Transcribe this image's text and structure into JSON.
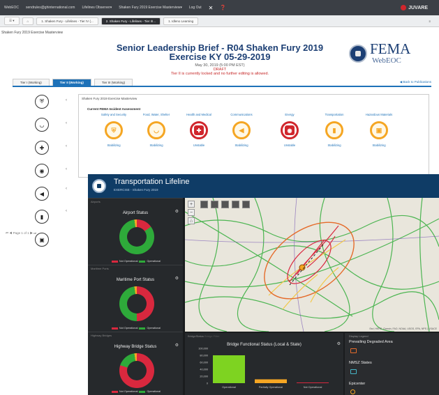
{
  "topbar": {
    "items": [
      "WebEOC",
      "sendrules@ghinternational.com",
      "Lifelines Observer▾",
      "Shaken Fury 2019 Exercise Masterview▾",
      "Log Out"
    ],
    "brand": "JUVARE"
  },
  "tabs": [
    {
      "label": "1. Shaken Fury - Lifelines - Tier IV (...",
      "active": false
    },
    {
      "label": "2. Shaken Fury - Lifelines - Tier I/I...",
      "active": true
    },
    {
      "label": "1. Idleno Learning",
      "active": false
    }
  ],
  "breadcrumb": "Shaken Fury 2019 Exercise Masterview",
  "header": {
    "title": "Senior Leadership Brief - R04 Shaken Fury 2019",
    "subtitle": "Exercise KY 05-29-2019",
    "date": "May 30, 2019 (5:00 PM EST)",
    "draft": "DRAFT",
    "locked": "Tier II is currently locked and no further editing is allowed."
  },
  "logo": {
    "name": "FEMA",
    "sub": "WebEOC"
  },
  "tier_tabs": [
    "Tier I (Working)",
    "Tier II (Working)",
    "Tier III (Working)"
  ],
  "back_link": "Back to Publications",
  "panel": {
    "title": "Shaken Fury 2019 Exercise Masterview",
    "assessment": "Current FEMA Incident Assessment",
    "lifelines": [
      {
        "name": "Safety and Security",
        "status": "Stabilizing",
        "icon": "shield-icon",
        "state": "yellow"
      },
      {
        "name": "Food, Water, Shelter",
        "status": "Stabilizing",
        "icon": "food-icon",
        "state": "yellow"
      },
      {
        "name": "Health and Medical",
        "status": "Unstable",
        "icon": "medical-icon",
        "state": "red"
      },
      {
        "name": "Communications",
        "status": "Stabilizing",
        "icon": "communications-icon",
        "state": "yellow"
      },
      {
        "name": "Energy",
        "status": "Unstable",
        "icon": "energy-icon",
        "state": "red"
      },
      {
        "name": "Transportation",
        "status": "Stabilizing",
        "icon": "transportation-icon",
        "state": "yellow"
      },
      {
        "name": "Hazardous Materials",
        "status": "Stabilizing",
        "icon": "hazmat-icon",
        "state": "yellow"
      }
    ]
  },
  "pager": "Page 1 of 1",
  "dashboard": {
    "title": "Transportation Lifeline",
    "exercise": "EXERCISE - Shaken Fury 2019",
    "widgets": [
      {
        "section": "Airports",
        "title": "Airport Status",
        "not_operational": 0.15
      },
      {
        "section": "Maritime Ports",
        "title": "Maritime Port Status",
        "not_operational": 0.5
      },
      {
        "section": "Highway Bridges",
        "title": "Highway Bridge Status",
        "not_operational": 0.8
      }
    ],
    "legend_not_operational": "Not Operational",
    "legend_operational": "Operational",
    "colors": {
      "operational": "#2eaa3a",
      "not_operational": "#d9283e",
      "partial": "#f5a623"
    },
    "bridge_tabs": [
      "BridgeStatus",
      "Bridge Filter"
    ],
    "map_attribution": "Esri, HERE, Garmin, FAO, NOAA, USGS, EPA, NPS | USACE",
    "legend_panel": {
      "header": "Display Legend",
      "items": [
        "Prevailing Degraded Area",
        "NMSZ States",
        "Epicenter"
      ]
    }
  },
  "chart_data": {
    "type": "bar",
    "title": "Bridge Functional Status (Local & State)",
    "categories": [
      "Operational",
      "Partially Operational",
      "Not Operational"
    ],
    "values": [
      80000,
      11000,
      1500
    ],
    "colors": [
      "#7ed321",
      "#f5a623",
      "#d9283e"
    ],
    "ylim": [
      0,
      100000
    ],
    "yticks": [
      "100,000",
      "80,000",
      "60,000",
      "40,000",
      "20,000",
      "0"
    ]
  }
}
